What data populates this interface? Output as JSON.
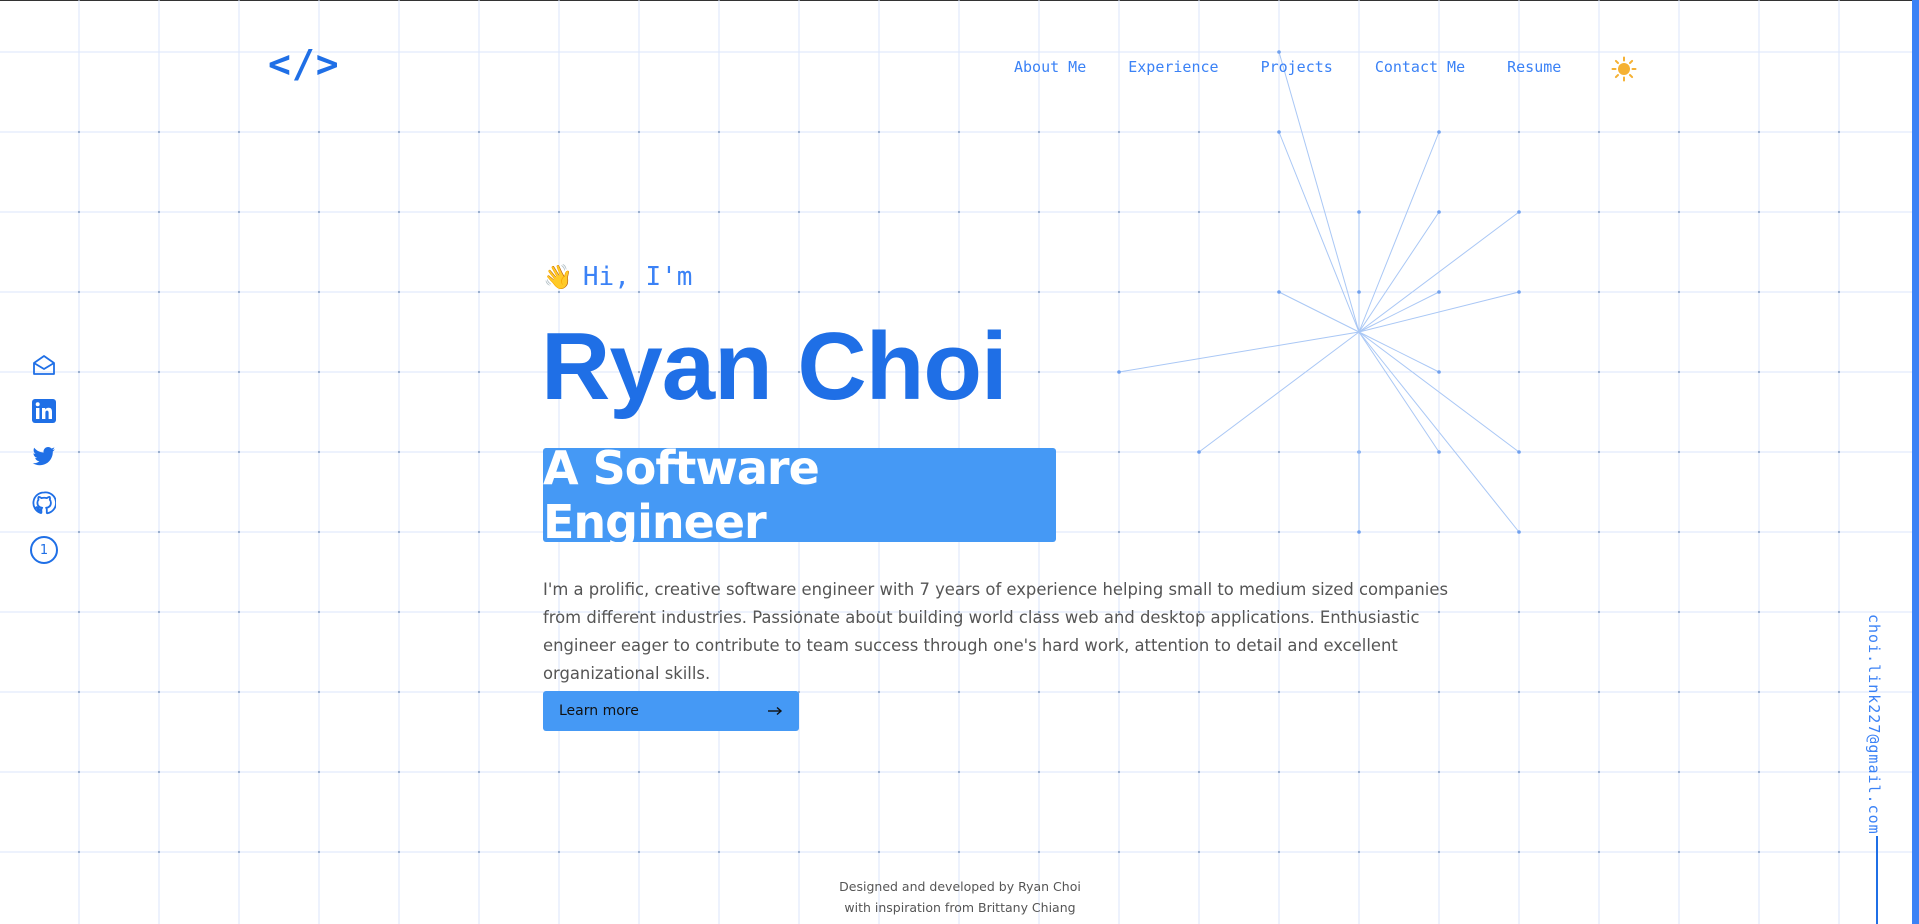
{
  "logo": {
    "text": "</>"
  },
  "nav": {
    "items": [
      {
        "label": "About Me"
      },
      {
        "label": "Experience"
      },
      {
        "label": "Projects"
      },
      {
        "label": "Contact Me"
      },
      {
        "label": "Resume"
      }
    ],
    "theme_icon": "sun-icon"
  },
  "social": {
    "icons": [
      "mail-icon",
      "linkedin-icon",
      "twitter-icon",
      "github-icon"
    ],
    "badge": "1"
  },
  "hero": {
    "greeting_icon": "waving-hand-icon",
    "greeting": "Hi, I'm",
    "name": "Ryan Choi",
    "role": "A Software Engineer",
    "description": "I'm a prolific, creative software engineer with 7 years of experience helping small to medium sized companies from different industries. Passionate about building world class web and desktop applications. Enthusiastic engineer eager to contribute to team success through one's hard work, attention to detail and excellent organizational skills.",
    "cta_label": "Learn more",
    "cta_icon": "arrow-right-icon"
  },
  "footer": {
    "line1": "Designed and developed by Ryan Choi",
    "line2": "with inspiration from Brittany Chiang"
  },
  "side_email": "choi.link227@gmail.com",
  "colors": {
    "accent": "#1f6fe6",
    "accent_light": "#4599f5",
    "grid_line": "#dbe5fb",
    "star_line": "#a9c7f5"
  }
}
